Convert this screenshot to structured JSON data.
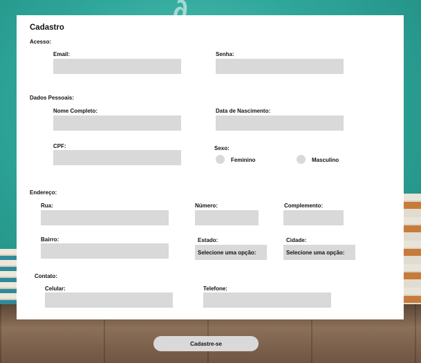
{
  "form": {
    "title": "Cadastro",
    "acesso": {
      "section": "Acesso:",
      "email_label": "Email:",
      "senha_label": "Senha:"
    },
    "dados_pessoais": {
      "section": "Dados Pessoais:",
      "nome_label": "Nome Completo:",
      "nascimento_label": "Data de Nascimento:",
      "cpf_label": "CPF:",
      "sexo_label": "Sexo:",
      "sexo_options": [
        "Feminino",
        "Masculino"
      ]
    },
    "endereco": {
      "section": "Endereço:",
      "rua_label": "Rua:",
      "numero_label": "Número:",
      "complemento_label": "Complemento:",
      "bairro_label": "Bairro:",
      "estado_label": "Estado:",
      "estado_value": "Selecione uma opção:",
      "cidade_label": "Cidade:",
      "cidade_value": "Selecione uma opção:"
    },
    "contato": {
      "section": "Contato:",
      "celular_label": "Celular:",
      "telefone_label": "Telefone:"
    },
    "submit_label": "Cadastre-se"
  }
}
